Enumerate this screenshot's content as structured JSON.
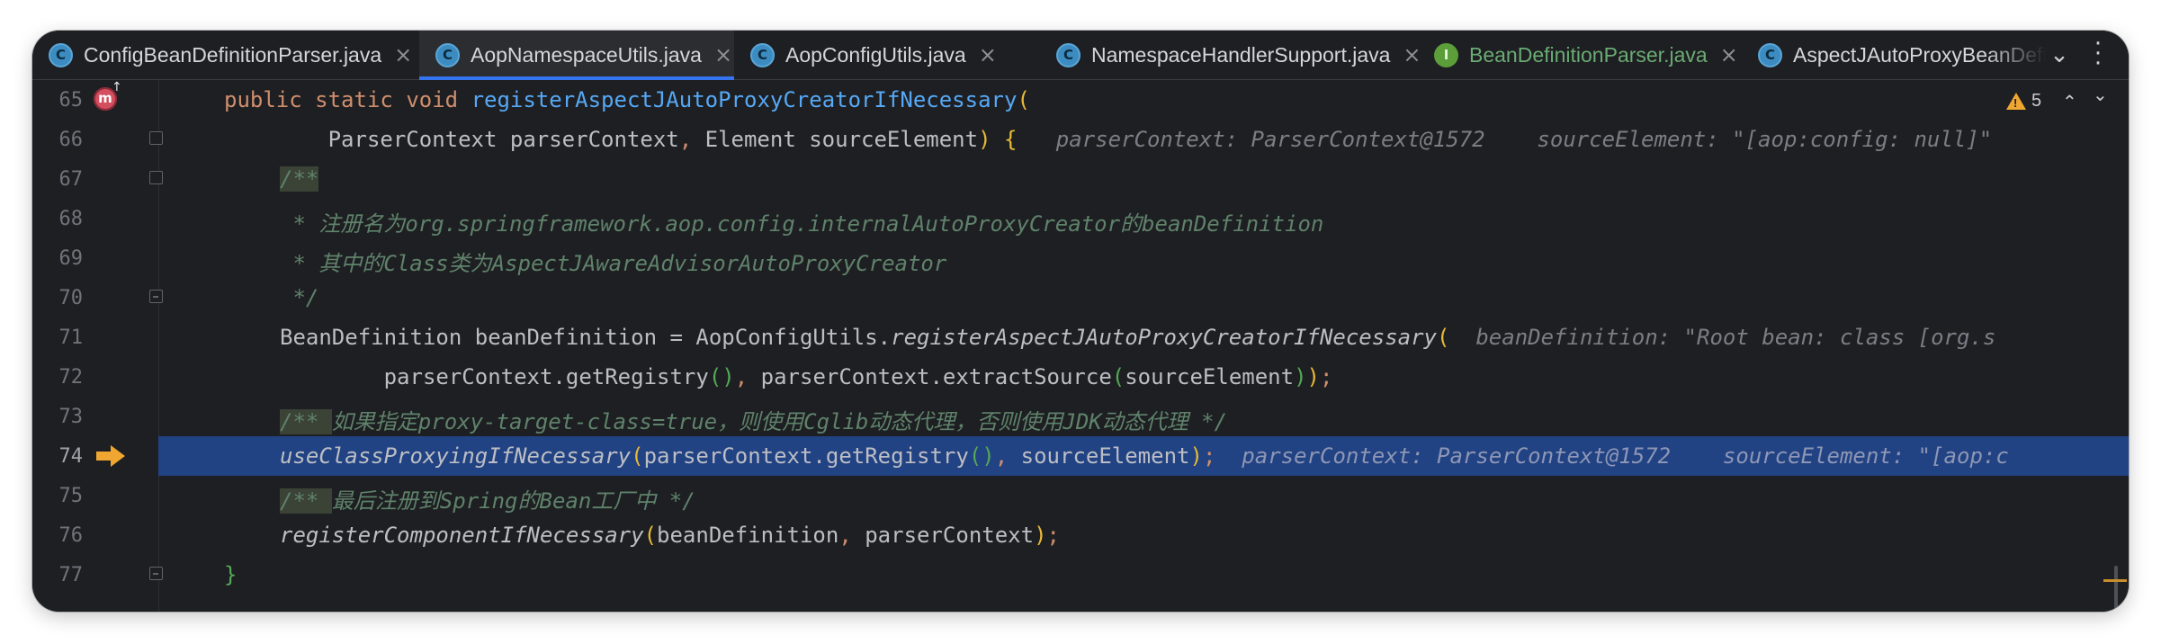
{
  "tabs": [
    {
      "icon": "C",
      "type": "class",
      "label": "ConfigBeanDefinitionParser.java",
      "close": "×",
      "active": false
    },
    {
      "icon": "C",
      "type": "class",
      "label": "AopNamespaceUtils.java",
      "close": "×",
      "active": true
    },
    {
      "icon": "C",
      "type": "class",
      "label": "AopConfigUtils.java",
      "close": "×",
      "active": false
    },
    {
      "icon": "C",
      "type": "class",
      "label": "NamespaceHandlerSupport.java",
      "close": "×",
      "active": false
    },
    {
      "icon": "I",
      "type": "interface",
      "label": "BeanDefinitionParser.java",
      "close": "×",
      "active": false
    },
    {
      "icon": "C",
      "type": "class",
      "label": "AspectJAutoProxyBeanDefini",
      "active": false
    }
  ],
  "tabbar": {
    "overflow_icon": "⌄",
    "more_icon": "⋮"
  },
  "editor": {
    "warnings": {
      "count": "5",
      "symbol": "!",
      "up": "⌃",
      "down": "⌄"
    },
    "method_marker": "m",
    "current_line": "74",
    "lines": [
      {
        "num": "65",
        "t": [
          "public",
          " ",
          "static",
          " ",
          "void",
          " ",
          "registerAspectJAutoProxyCreatorIfNecessary",
          "("
        ]
      },
      {
        "num": "66",
        "t": [
          "        ParserContext parserContext",
          ",",
          " Element sourceElement",
          ")",
          " ",
          "{"
        ],
        "hint": "parserContext: ParserContext@1572    sourceElement: \"[aop:config: null]\""
      },
      {
        "num": "67",
        "t": [
          "/**"
        ]
      },
      {
        "num": "68",
        "t": [
          " * 注册名为org.springframework.aop.config.internalAutoProxyCreator的beanDefinition"
        ]
      },
      {
        "num": "69",
        "t": [
          " * 其中的Class类为AspectJAwareAdvisorAutoProxyCreator"
        ]
      },
      {
        "num": "70",
        "t": [
          " */"
        ]
      },
      {
        "num": "71",
        "t": [
          "BeanDefinition beanDefinition = AopConfigUtils.",
          "registerAspectJAutoProxyCreatorIfNecessary",
          "("
        ],
        "hint": "beanDefinition: \"Root bean: class [org.s"
      },
      {
        "num": "72",
        "t": [
          "        parserContext.getRegistry",
          "()",
          ", ",
          "parserContext.extractSource",
          "(",
          "sourceElement",
          ")",
          ")",
          ";"
        ]
      },
      {
        "num": "73",
        "t": [
          "/** ",
          "如果指定proxy-target-class=true，则使用Cglib动态代理，否则使用JDK动态代理",
          " */"
        ]
      },
      {
        "num": "74",
        "t": [
          "useClassProxyingIfNecessary",
          "(",
          "parserContext.getRegistry",
          "()",
          ", ",
          "sourceElement",
          ")",
          ";"
        ],
        "hint": "parserContext: ParserContext@1572    sourceElement: \"[aop:c"
      },
      {
        "num": "75",
        "t": [
          "/** ",
          "最后注册到Spring的Bean工厂中",
          " */"
        ]
      },
      {
        "num": "76",
        "t": [
          "registerComponentIfNecessary",
          "(",
          "beanDefinition",
          ", ",
          "parserContext",
          ")",
          ";"
        ]
      },
      {
        "num": "77",
        "t": [
          "}"
        ]
      }
    ]
  },
  "colors": {
    "keyword": "#cf8e6d",
    "method": "#56a8f5",
    "paren1": "#e8ba36",
    "paren2": "#54a857",
    "doc": "#5f826b",
    "selection": "#214283",
    "warning": "#f0a732"
  }
}
